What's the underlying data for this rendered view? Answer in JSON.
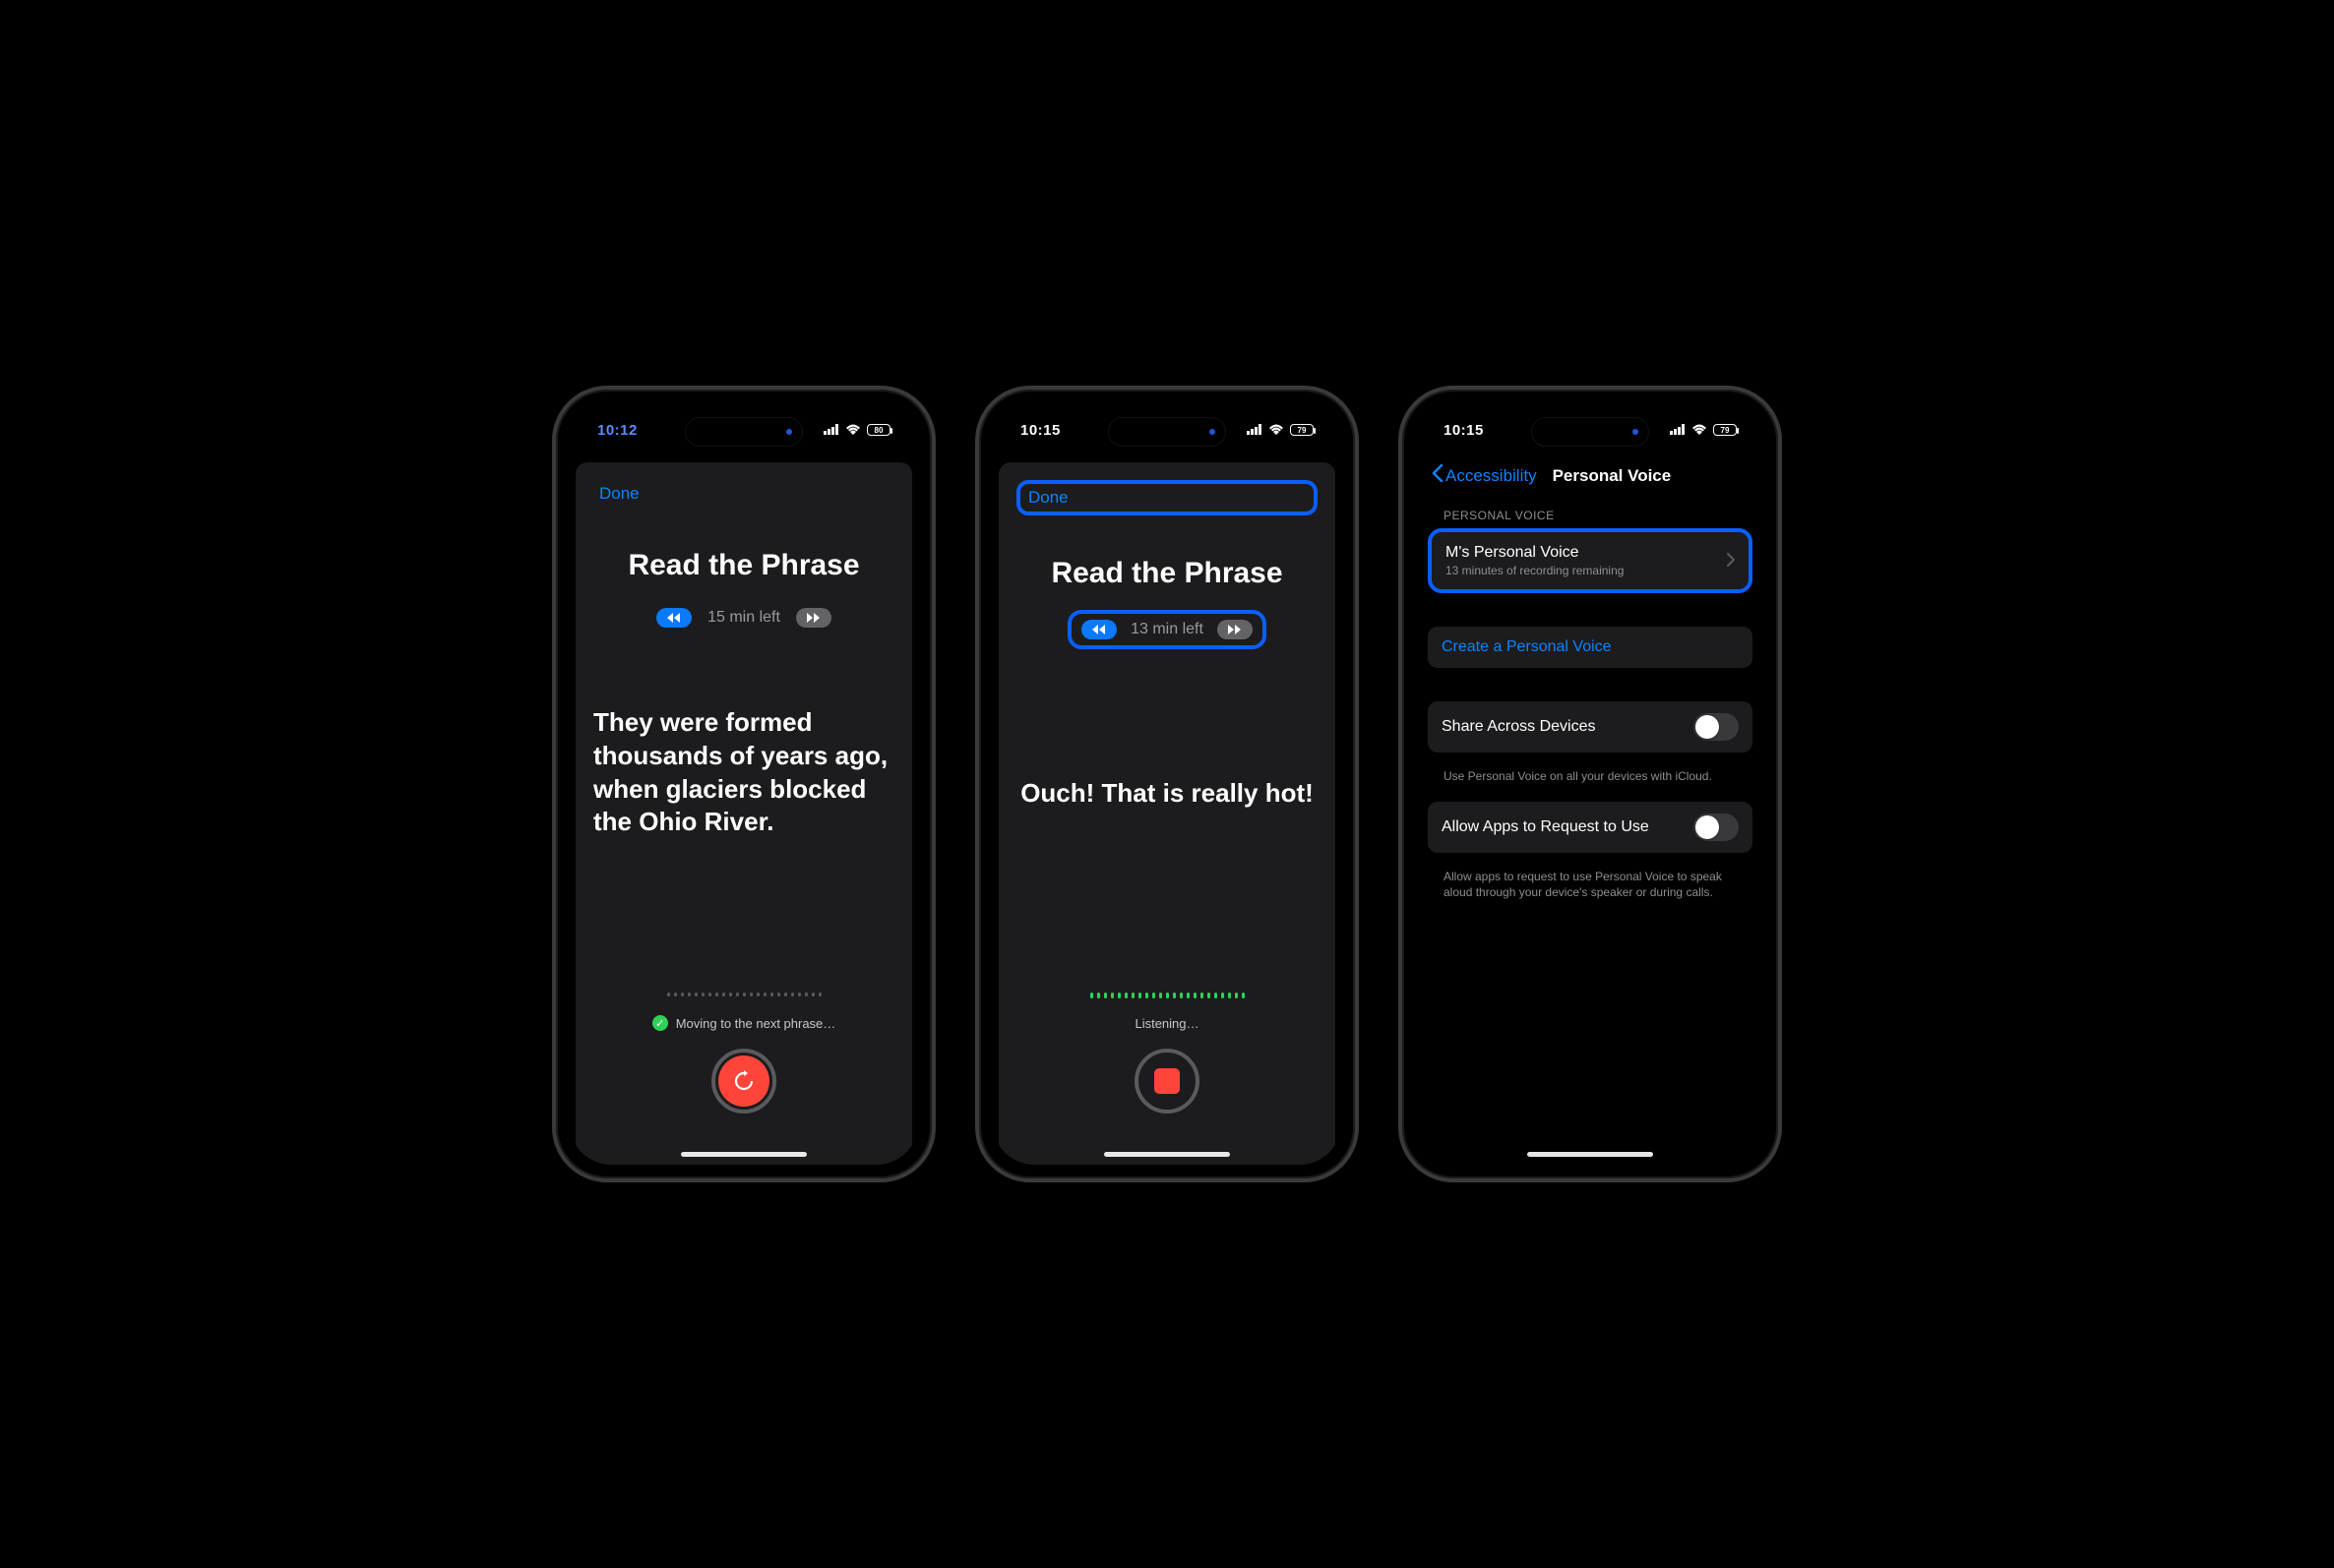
{
  "phone1": {
    "time": "10:12",
    "battery": "80",
    "done": "Done",
    "title": "Read the Phrase",
    "time_left": "15 min left",
    "phrase": "They were formed thousands of years ago, when glaciers blocked the Ohio River.",
    "status_text": "Moving to the next phrase…"
  },
  "phone2": {
    "time": "10:15",
    "battery": "79",
    "done": "Done",
    "title": "Read the Phrase",
    "time_left": "13 min left",
    "phrase": "Ouch! That is really hot!",
    "status_text": "Listening…"
  },
  "phone3": {
    "time": "10:15",
    "battery": "79",
    "back_label": "Accessibility",
    "nav_title": "Personal Voice",
    "section_header": "PERSONAL VOICE",
    "voice_name": "M's Personal Voice",
    "voice_sub": "13 minutes of recording remaining",
    "create_label": "Create a Personal Voice",
    "share_label": "Share Across Devices",
    "share_note": "Use Personal Voice on all your devices with iCloud.",
    "allow_label": "Allow Apps to Request to Use",
    "allow_note": "Allow apps to request to use Personal Voice to speak aloud through your device's speaker or during calls."
  }
}
